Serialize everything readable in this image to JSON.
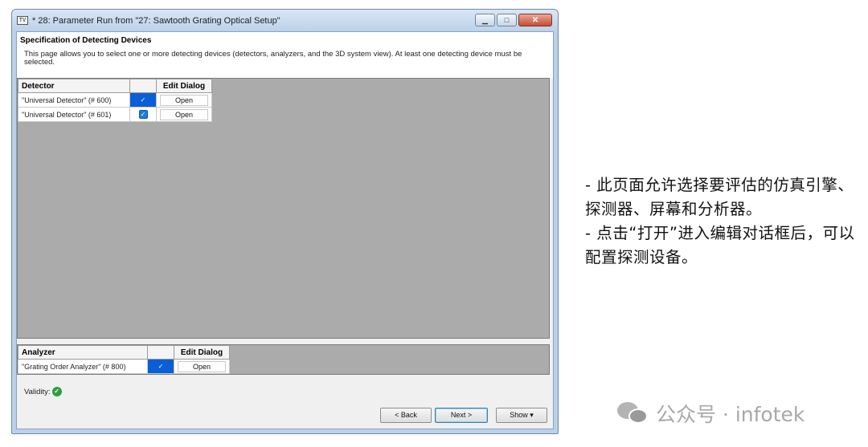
{
  "window": {
    "title": "* 28: Parameter Run from \"27: Sawtooth Grating Optical Setup\"",
    "icon_text": "TV"
  },
  "page": {
    "section_title": "Specification of Detecting Devices",
    "description": "This page allows you to select one or more detecting devices (detectors, analyzers, and the 3D system view). At least one detecting device must be selected."
  },
  "detector_table": {
    "headers": {
      "name": "Detector",
      "check": "",
      "dialog": "Edit Dialog"
    },
    "rows": [
      {
        "name": "\"Universal Detector\" (# 600)",
        "checked": true,
        "button": "Open"
      },
      {
        "name": "\"Universal Detector\" (# 601)",
        "checked": true,
        "button": "Open"
      }
    ]
  },
  "analyzer_table": {
    "headers": {
      "name": "Analyzer",
      "check": "",
      "dialog": "Edit Dialog"
    },
    "rows": [
      {
        "name": "\"Grating Order Analyzer\" (# 800)",
        "checked": true,
        "button": "Open"
      }
    ]
  },
  "footer": {
    "validity_label": "Validity:",
    "validity_icon": "check-circle-icon",
    "back": "< Back",
    "next": "Next >",
    "show": "Show ▾"
  },
  "notes": {
    "line1": "- 此页面允许选择要评估的仿真引擎、探测器、屏幕和分析器。",
    "line2": "- 点击“打开”进入编辑对话框后，可以配置探测设备。"
  },
  "watermark": {
    "text": "公众号 · infotek"
  },
  "colors": {
    "selection": "#0a5fd6",
    "check": "#1e7be3",
    "valid": "#2e9e3b",
    "grid_bg": "#ababab"
  }
}
